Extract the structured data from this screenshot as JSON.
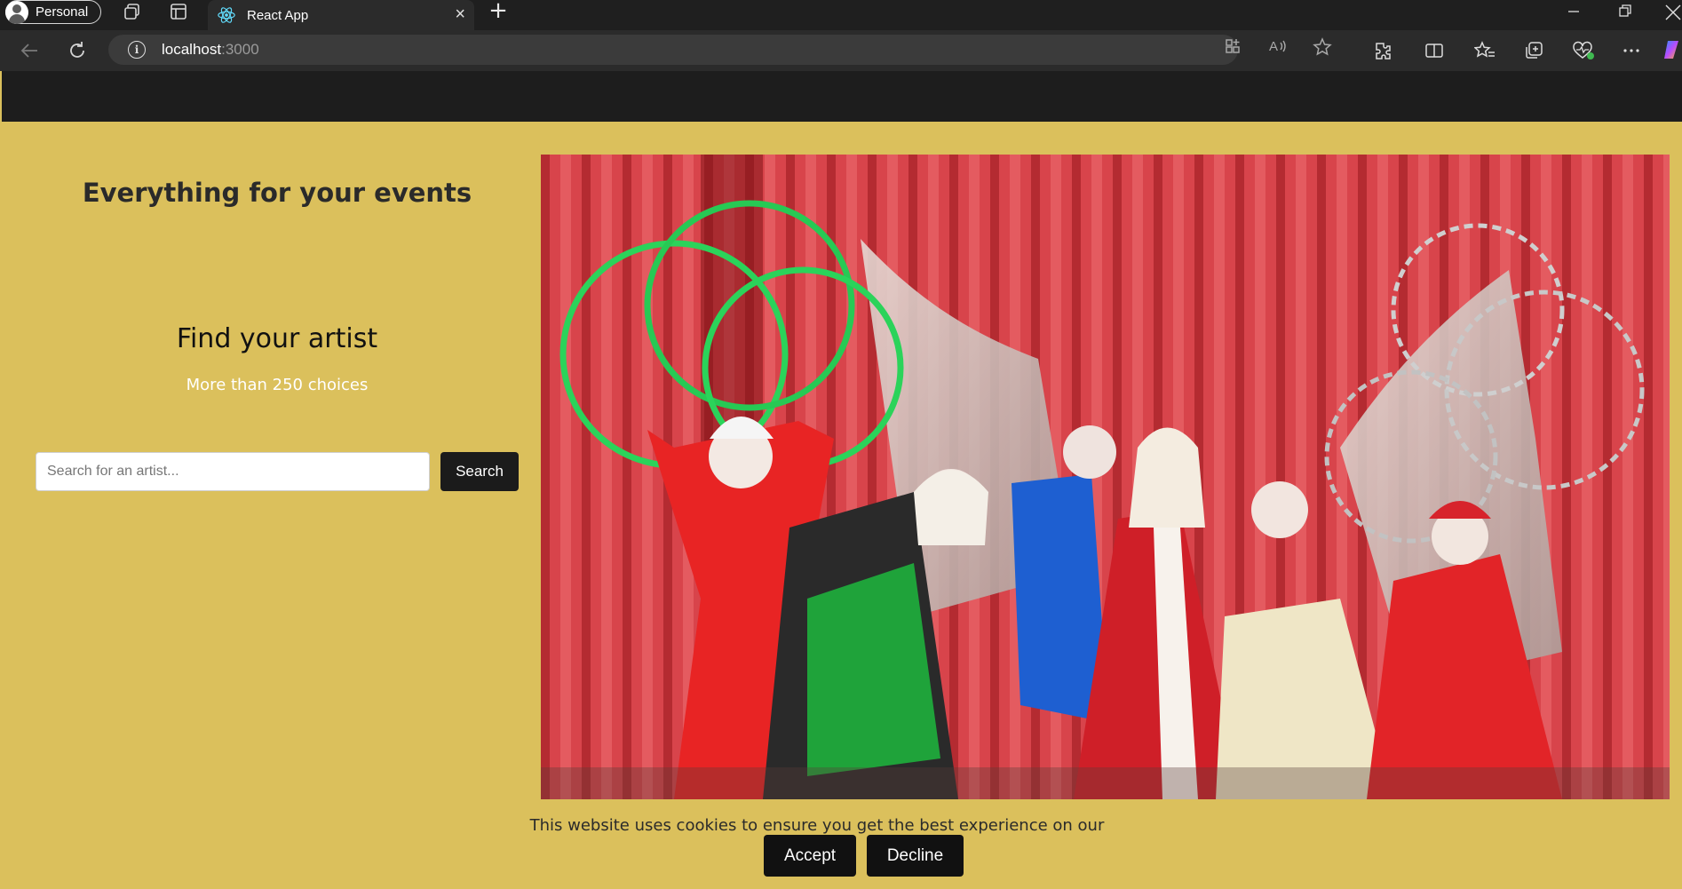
{
  "browser": {
    "profile_label": "Personal",
    "tab_title": "React App",
    "url_host": "localhost",
    "url_port": ":3000"
  },
  "page": {
    "title": "Everything for your events",
    "find_title": "Find your artist",
    "choices_text": "More than 250 choices",
    "search_placeholder": "Search for an artist...",
    "search_button": "Search"
  },
  "cookie": {
    "message": "This website uses cookies to ensure you get the best experience on our website.",
    "accept": "Accept",
    "decline": "Decline"
  },
  "colors": {
    "page_background": "#dbc05c",
    "header_background": "#1d1d1d",
    "button_background": "#1b1b1b"
  }
}
